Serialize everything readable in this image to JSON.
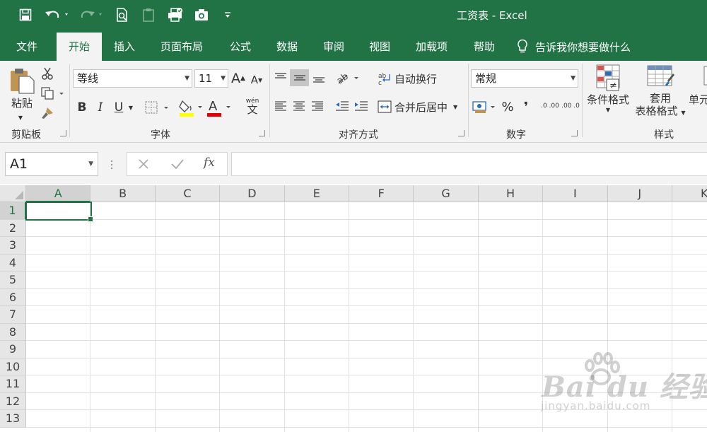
{
  "window": {
    "title": "工资表  -  Excel"
  },
  "tabs": [
    "文件",
    "开始",
    "插入",
    "页面布局",
    "公式",
    "数据",
    "审阅",
    "视图",
    "加载项",
    "帮助"
  ],
  "active_tab": "开始",
  "tell_me": "告诉我你想要做什么",
  "ribbon": {
    "clipboard": {
      "paste": "粘贴",
      "label": "剪贴板"
    },
    "font": {
      "name": "等线",
      "size": "11",
      "label": "字体",
      "bold": "B",
      "italic": "I",
      "underline": "U",
      "phonetic_top": "wén",
      "phonetic_bottom": "文"
    },
    "alignment": {
      "wrap_text": "自动换行",
      "merge_center": "合并后居中",
      "label": "对齐方式"
    },
    "number": {
      "format": "常规",
      "percent": "%",
      "comma": "❜",
      "dec_inc": ".0 .00",
      "dec_dec": ".00 .0",
      "label": "数字"
    },
    "styles": {
      "cond_format": "条件格式",
      "table_format_1": "套用",
      "table_format_2": "表格格式",
      "cell_styles": "单元",
      "label": "样式"
    }
  },
  "formula_bar": {
    "name_box": "A1",
    "fx": "fx",
    "formula": ""
  },
  "grid": {
    "columns": [
      "A",
      "B",
      "C",
      "D",
      "E",
      "F",
      "G",
      "H",
      "I",
      "J",
      "K"
    ],
    "rows": [
      "1",
      "2",
      "3",
      "4",
      "5",
      "6",
      "7",
      "8",
      "9",
      "10",
      "11",
      "12",
      "13"
    ],
    "active_cell": "A1"
  },
  "watermark": {
    "main": "Bai du 经验",
    "sub": "jingyan.baidu.com"
  },
  "colors": {
    "accent": "#217346",
    "ribbon_bg": "#f3f3f3",
    "font_color_bar": "#e00000",
    "fill_color_bar": "#ffff00"
  }
}
